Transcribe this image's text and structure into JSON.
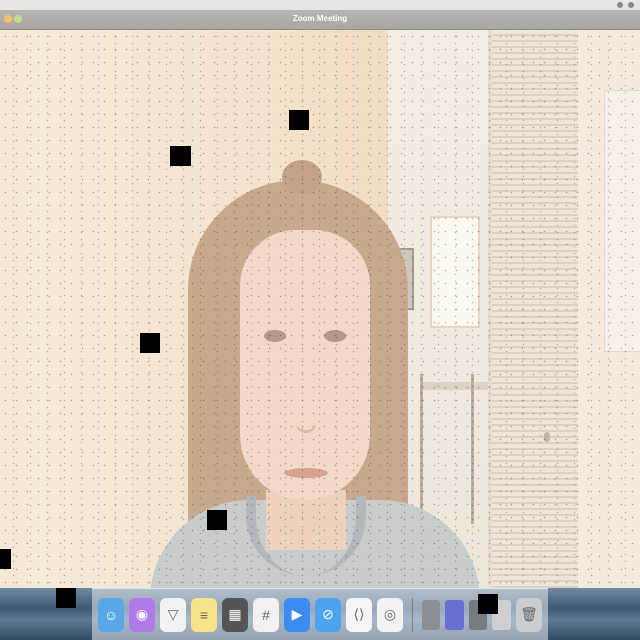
{
  "window": {
    "title": "Zoom Meeting"
  },
  "menubar": {
    "app_menu": [
      "",
      "",
      ""
    ]
  },
  "dock": {
    "apps": [
      {
        "name": "finder-icon",
        "color": "#5aa7e8",
        "glyph": "☺"
      },
      {
        "name": "podcasts-icon",
        "color": "#b07ae8",
        "glyph": "◉"
      },
      {
        "name": "brave-icon",
        "color": "#f2f2f2",
        "glyph": "▽"
      },
      {
        "name": "notes-icon",
        "color": "#f7e38a",
        "glyph": "≡"
      },
      {
        "name": "calculator-icon",
        "color": "#555555",
        "glyph": "▦"
      },
      {
        "name": "slack-icon",
        "color": "#f4f0f0",
        "glyph": "#"
      },
      {
        "name": "zoom-icon",
        "color": "#3b8cf2",
        "glyph": "▶"
      },
      {
        "name": "safari-icon",
        "color": "#4da3f0",
        "glyph": "⊘"
      },
      {
        "name": "vscode-icon",
        "color": "#f4f6f8",
        "glyph": "⟨⟩"
      },
      {
        "name": "chrome-icon",
        "color": "#f2f2f2",
        "glyph": "◎"
      }
    ]
  },
  "colors": {
    "accent": "#3b8cf2",
    "title_text": "#ffffff"
  }
}
